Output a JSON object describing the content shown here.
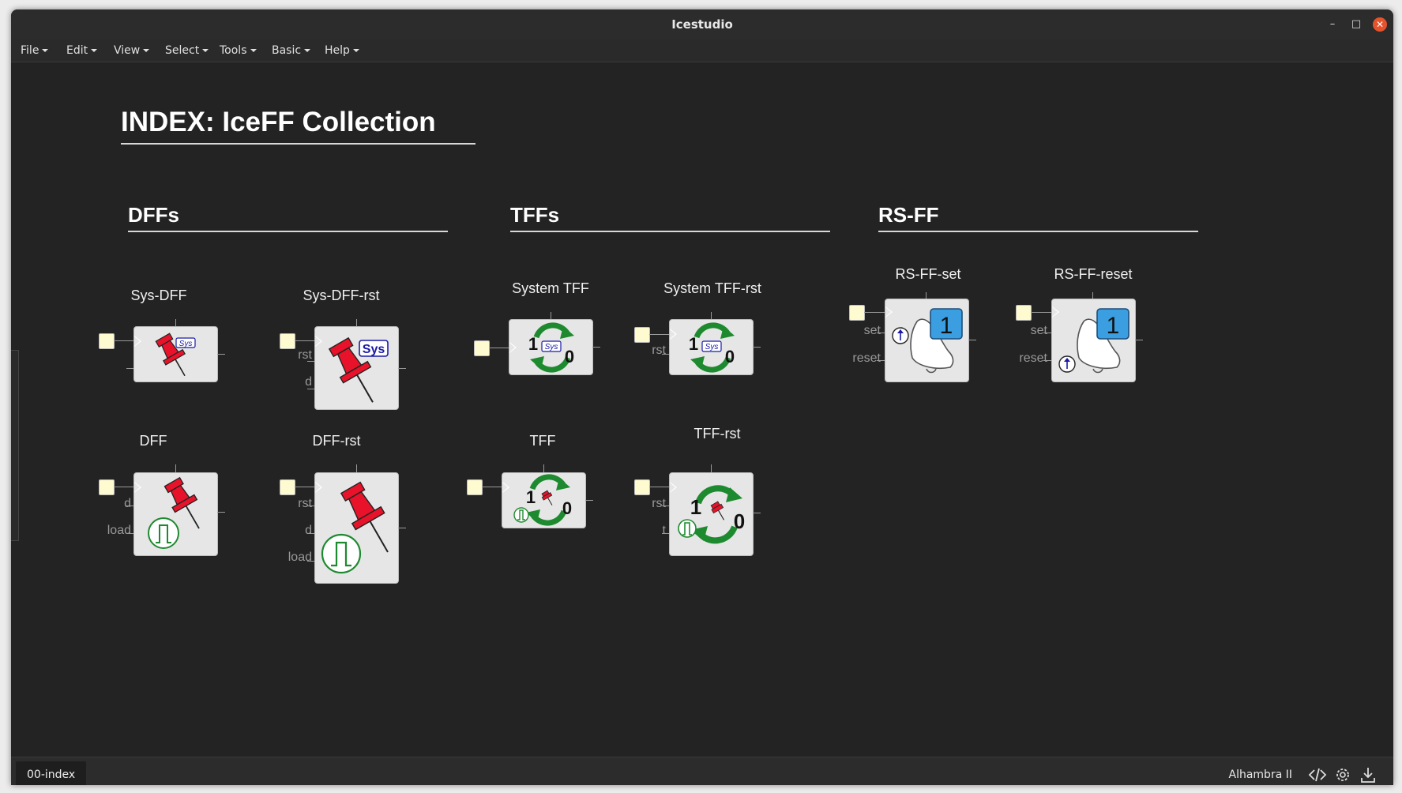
{
  "window": {
    "title": "Icestudio"
  },
  "menu": [
    {
      "label": "File"
    },
    {
      "label": "Edit"
    },
    {
      "label": "View"
    },
    {
      "label": "Select"
    },
    {
      "label": "Tools"
    },
    {
      "label": "Basic"
    },
    {
      "label": "Help"
    }
  ],
  "page": {
    "title": "INDEX: IceFF Collection",
    "sections": {
      "dffs": "DFFs",
      "tffs": "TFFs",
      "rsff": "RS-FF"
    }
  },
  "blocks": {
    "sys_dff": {
      "label": "Sys-DFF"
    },
    "sys_dff_rst": {
      "label": "Sys-DFF-rst",
      "ports": [
        "rst",
        "d"
      ]
    },
    "dff": {
      "label": "DFF",
      "ports": [
        "d",
        "load"
      ]
    },
    "dff_rst": {
      "label": "DFF-rst",
      "ports": [
        "rst",
        "d",
        "load"
      ]
    },
    "system_tff": {
      "label": "System TFF"
    },
    "system_tff_rst": {
      "label": "System TFF-rst",
      "ports": [
        "rst"
      ]
    },
    "tff": {
      "label": "TFF"
    },
    "tff_rst": {
      "label": "TFF-rst",
      "ports": [
        "rst",
        "t"
      ]
    },
    "rs_ff_set": {
      "label": "RS-FF-set",
      "ports": [
        "set",
        "reset"
      ]
    },
    "rs_ff_reset": {
      "label": "RS-FF-reset",
      "ports": [
        "set",
        "reset"
      ]
    }
  },
  "icon_text": {
    "sys": "Sys",
    "one": "1",
    "zero": "0"
  },
  "footer": {
    "tab": "00-index",
    "board": "Alhambra II"
  },
  "icons": [
    "code-icon",
    "gear-icon",
    "download-icon",
    "pin-icon",
    "refresh-icon",
    "bell-icon",
    "pulse-icon",
    "up-arrow-icon"
  ],
  "colors": {
    "pin_red": "#e8132a",
    "refresh_green": "#1e8a2f",
    "bell_blue": "#3a9ee0",
    "close": "#e5532d",
    "background": "#232323"
  }
}
